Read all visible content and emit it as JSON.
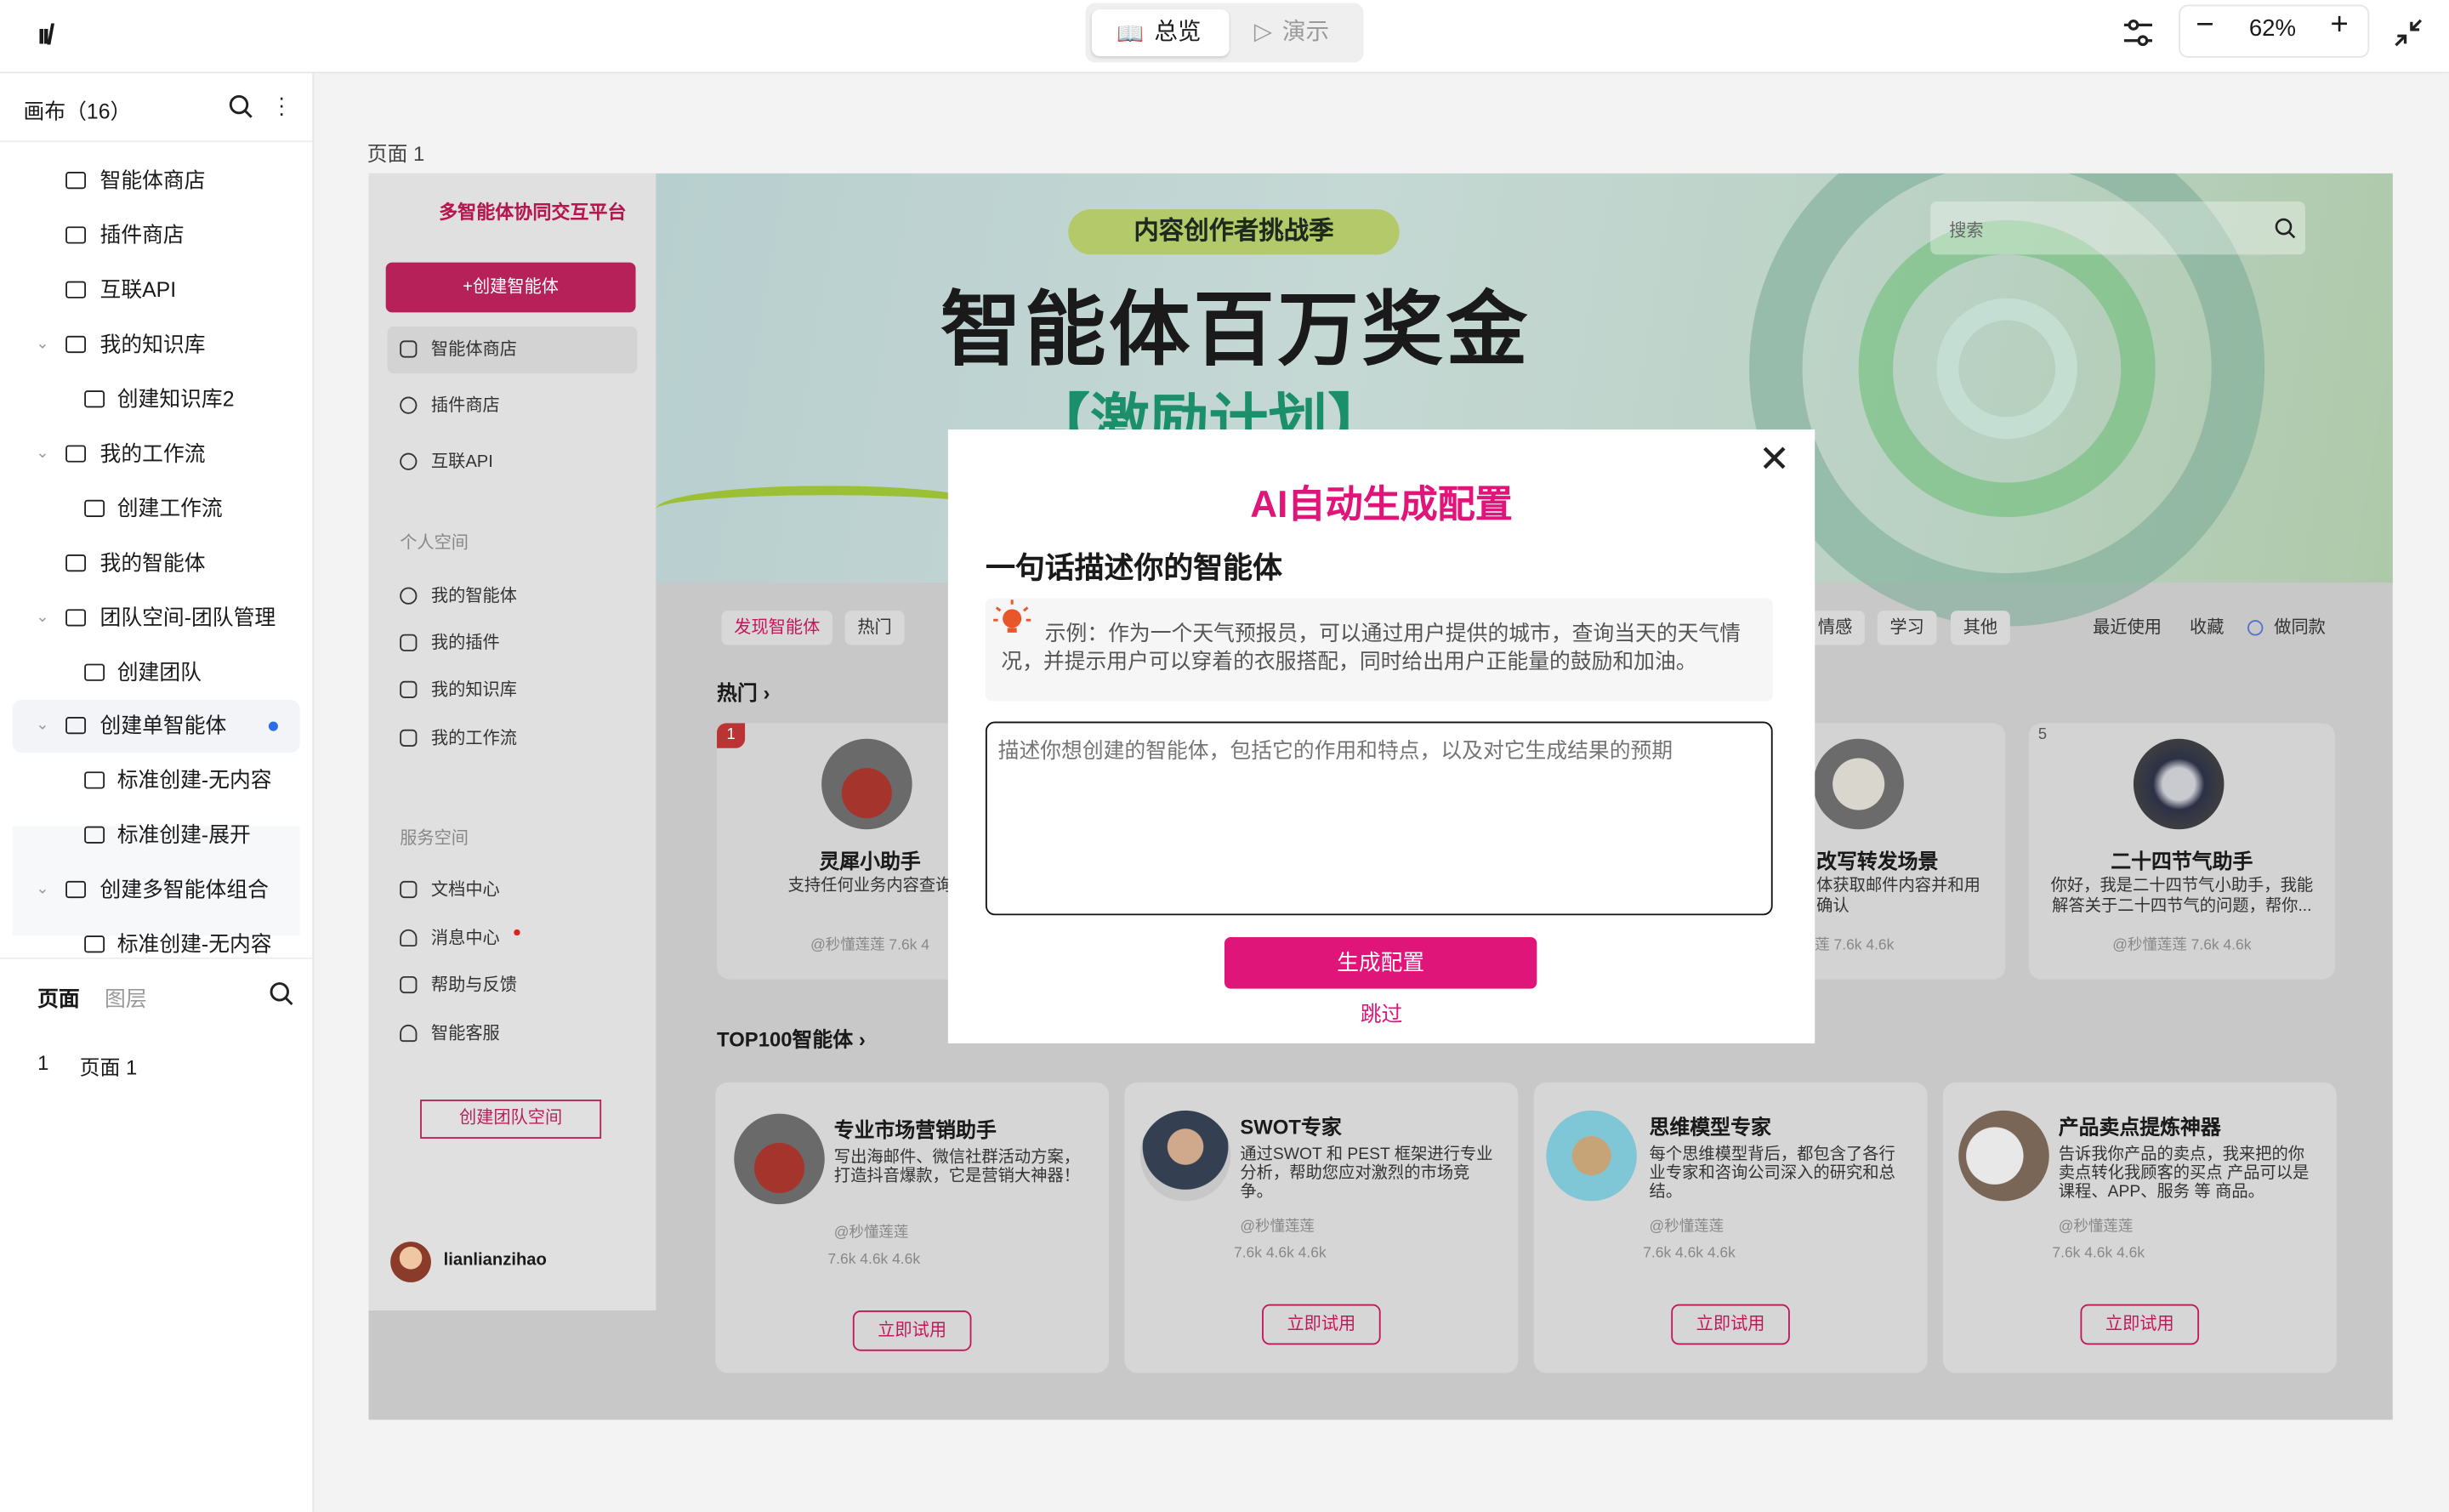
{
  "topbar": {
    "seg_overview": "总览",
    "seg_present": "演示",
    "zoom": "62%"
  },
  "left_panel": {
    "header": "画布（16）",
    "tree": [
      {
        "label": "智能体商店"
      },
      {
        "label": "插件商店"
      },
      {
        "label": "互联API"
      },
      {
        "label": "我的知识库"
      },
      {
        "label": "创建知识库2"
      },
      {
        "label": "我的工作流"
      },
      {
        "label": "创建工作流"
      },
      {
        "label": "我的智能体"
      },
      {
        "label": "团队空间-团队管理"
      },
      {
        "label": "创建团队"
      },
      {
        "label": "创建单智能体"
      },
      {
        "label": "标准创建-无内容"
      },
      {
        "label": "标准创建-展开"
      },
      {
        "label": "创建多智能体组合"
      },
      {
        "label": "标准创建-无内容"
      }
    ],
    "tabs": {
      "pages": "页面",
      "layers": "图层"
    },
    "page_item": {
      "num": "1",
      "name": "页面 1"
    }
  },
  "canvas": {
    "page_label": "页面 1"
  },
  "app": {
    "brand": "多智能体协同交互平台",
    "create_btn": "+创建智能体",
    "nav": [
      "智能体商店",
      "插件商店",
      "互联API"
    ],
    "personal_title": "个人空间",
    "personal": [
      "我的智能体",
      "我的插件",
      "我的知识库",
      "我的工作流"
    ],
    "service_title": "服务空间",
    "service": [
      "文档中心",
      "消息中心",
      "帮助与反馈",
      "智能客服"
    ],
    "team_btn": "创建团队空间",
    "username": "lianlianzihao",
    "banner": {
      "tag": "内容创作者挑战季",
      "headline": "智能体百万奖金",
      "sub": "【激励计划】"
    },
    "search_placeholder": "搜索",
    "chips_left": [
      "发现智能体",
      "热门"
    ],
    "chips_right": [
      "情感",
      "学习",
      "其他"
    ],
    "filters": [
      "最近使用",
      "收藏",
      "做同款"
    ],
    "hot_title": "热门",
    "hot_cards": [
      {
        "rank": "1",
        "name": "灵犀小助手",
        "desc": "支持任何业务内容查询",
        "meta": "@秒懂莲莲  7.6k  4"
      },
      {
        "rank": "",
        "name": "改写转发场景",
        "desc": "体获取邮件内容并和用确认",
        "meta": "莲  7.6k  4.6k"
      },
      {
        "rank": "5",
        "name": "二十四节气助手",
        "desc": "你好，我是二十四节气小助手，我能解答关于二十四节气的问题，帮你...",
        "meta": "@秒懂莲莲  7.6k  4.6k"
      }
    ],
    "top_title": "TOP100智能体",
    "top_cards": [
      {
        "name": "专业市场营销助手",
        "desc": "写出海邮件、微信社群活动方案，打造抖音爆款，它是营销大神器！",
        "author": "@秒懂莲莲",
        "meta": "7.6k  4.6k  4.6k",
        "btn": "立即试用"
      },
      {
        "name": "SWOT专家",
        "desc": "通过SWOT 和 PEST 框架进行专业分析，帮助您应对激烈的市场竞争。",
        "author": "@秒懂莲莲",
        "meta": "7.6k  4.6k  4.6k",
        "btn": "立即试用"
      },
      {
        "name": "思维模型专家",
        "desc": "每个思维模型背后，都包含了各行业专家和咨询公司深入的研究和总结。",
        "author": "@秒懂莲莲",
        "meta": "7.6k  4.6k  4.6k",
        "btn": "立即试用"
      },
      {
        "name": "产品卖点提炼神器",
        "desc": "告诉我你产品的卖点，我来把的你卖点转化我顾客的买点 产品可以是课程、APP、服务 等 商品。",
        "author": "@秒懂莲莲",
        "meta": "7.6k  4.6k  4.6k",
        "btn": "立即试用"
      }
    ]
  },
  "modal": {
    "title": "AI自动生成配置",
    "subtitle": "一句话描述你的智能体",
    "example": "示例：作为一个天气预报员，可以通过用户提供的城市，查询当天的天气情况，并提示用户可以穿着的衣服搭配，同时给出用户正能量的鼓励和加油。",
    "placeholder": "描述你想创建的智能体，包括它的作用和特点，以及对它生成结果的预期",
    "generate": "生成配置",
    "skip": "跳过"
  },
  "colors": {
    "accent": "#e0157a",
    "brand_dark": "#c2185b"
  }
}
